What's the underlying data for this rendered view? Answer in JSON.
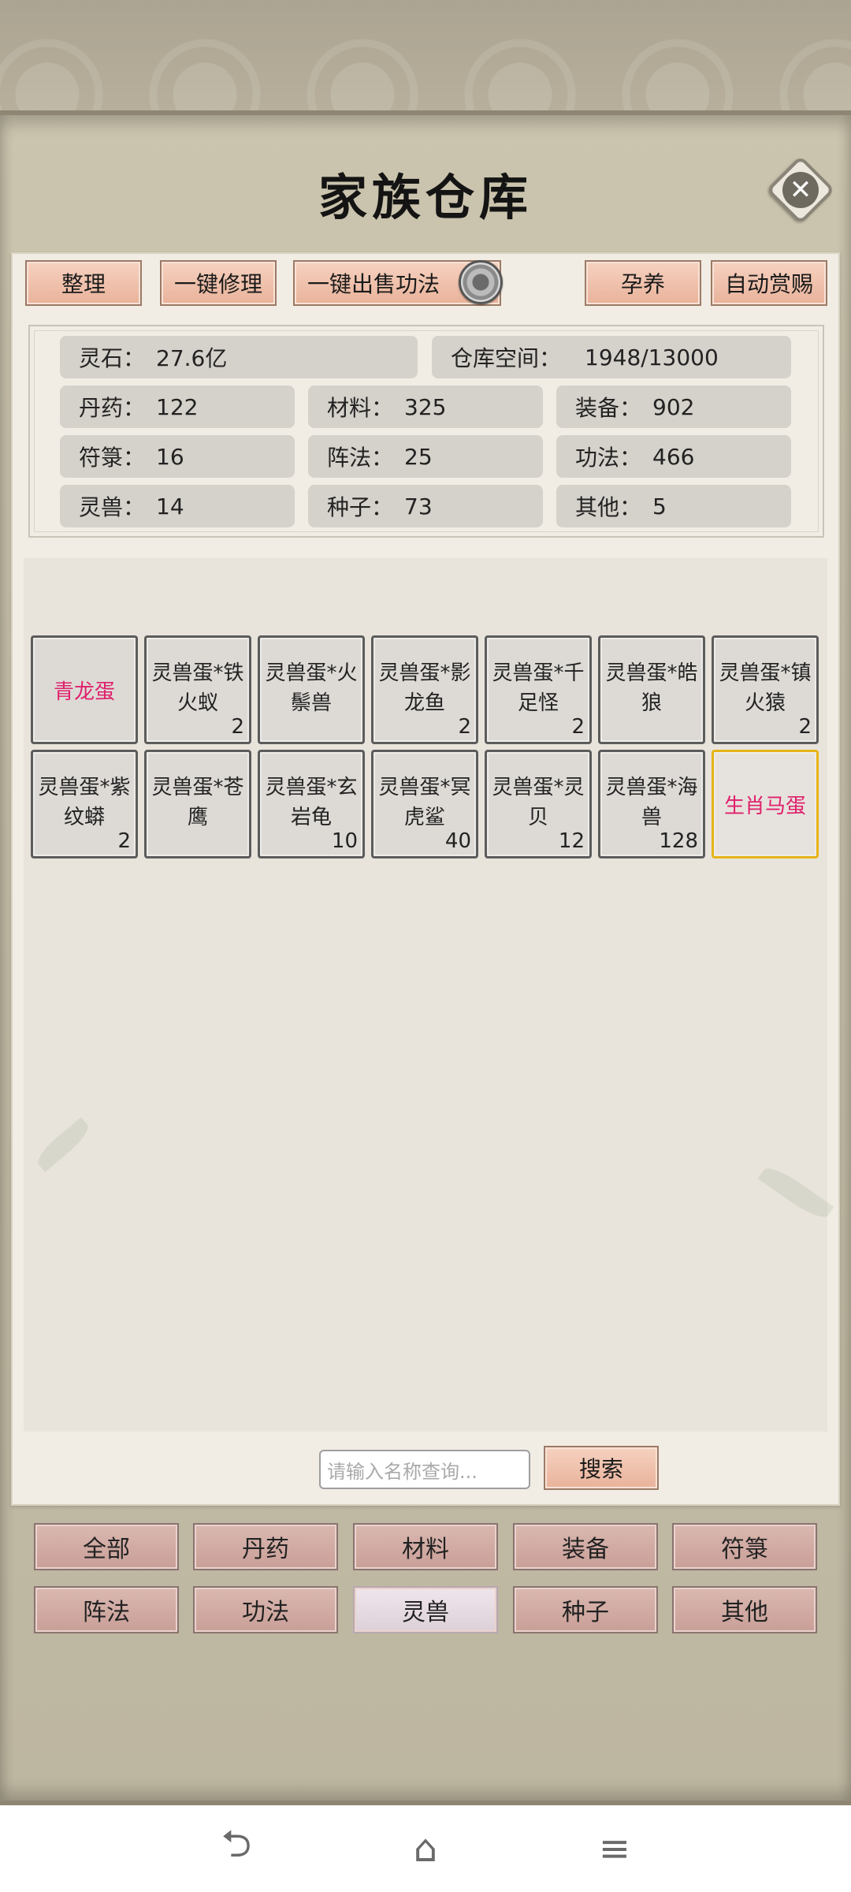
{
  "title": "家族仓库",
  "toolbar": {
    "organize": "整理",
    "repair_all": "一键修理",
    "sell_skills": "一键出售功法",
    "incubate": "孕养",
    "auto_reward": "自动赏赐"
  },
  "stats": {
    "spirit_stone": {
      "label": "灵石：",
      "value": "27.6亿"
    },
    "storage": {
      "label": "仓库空间：",
      "value": "1948/13000"
    },
    "pills": {
      "label": "丹药：",
      "value": "122"
    },
    "materials": {
      "label": "材料：",
      "value": "325"
    },
    "equipment": {
      "label": "装备：",
      "value": "902"
    },
    "talismans": {
      "label": "符箓：",
      "value": "16"
    },
    "formations": {
      "label": "阵法：",
      "value": "25"
    },
    "skills": {
      "label": "功法：",
      "value": "466"
    },
    "beasts": {
      "label": "灵兽：",
      "value": "14"
    },
    "seeds": {
      "label": "种子：",
      "value": "73"
    },
    "others": {
      "label": "其他：",
      "value": "5"
    }
  },
  "items": [
    {
      "line1": "青龙蛋",
      "line2": "",
      "count": ""
    },
    {
      "line1": "灵兽蛋*铁",
      "line2": "火蚁",
      "count": "2"
    },
    {
      "line1": "灵兽蛋*火",
      "line2": "鬃兽",
      "count": ""
    },
    {
      "line1": "灵兽蛋*影",
      "line2": "龙鱼",
      "count": "2"
    },
    {
      "line1": "灵兽蛋*千",
      "line2": "足怪",
      "count": "2"
    },
    {
      "line1": "灵兽蛋*皓",
      "line2": "狼",
      "count": ""
    },
    {
      "line1": "灵兽蛋*镇",
      "line2": "火猿",
      "count": "2"
    },
    {
      "line1": "灵兽蛋*紫",
      "line2": "纹蟒",
      "count": "2"
    },
    {
      "line1": "灵兽蛋*苍",
      "line2": "鹰",
      "count": ""
    },
    {
      "line1": "灵兽蛋*玄",
      "line2": "岩龟",
      "count": "10"
    },
    {
      "line1": "灵兽蛋*冥",
      "line2": "虎鲨",
      "count": "40"
    },
    {
      "line1": "灵兽蛋*灵",
      "line2": "贝",
      "count": "12"
    },
    {
      "line1": "灵兽蛋*海",
      "line2": "兽",
      "count": "128"
    },
    {
      "line1": "生肖马蛋",
      "line2": "",
      "count": ""
    }
  ],
  "search": {
    "placeholder": "请输入名称查询...",
    "button": "搜索"
  },
  "categories": [
    "全部",
    "丹药",
    "材料",
    "装备",
    "符箓",
    "阵法",
    "功法",
    "灵兽",
    "种子",
    "其他"
  ],
  "active_category": "灵兽",
  "colors": {
    "rare_item": "#e0206c",
    "highlight_border": "#e6b418"
  },
  "nav_icons": [
    "back-icon",
    "home-icon",
    "menu-icon"
  ]
}
